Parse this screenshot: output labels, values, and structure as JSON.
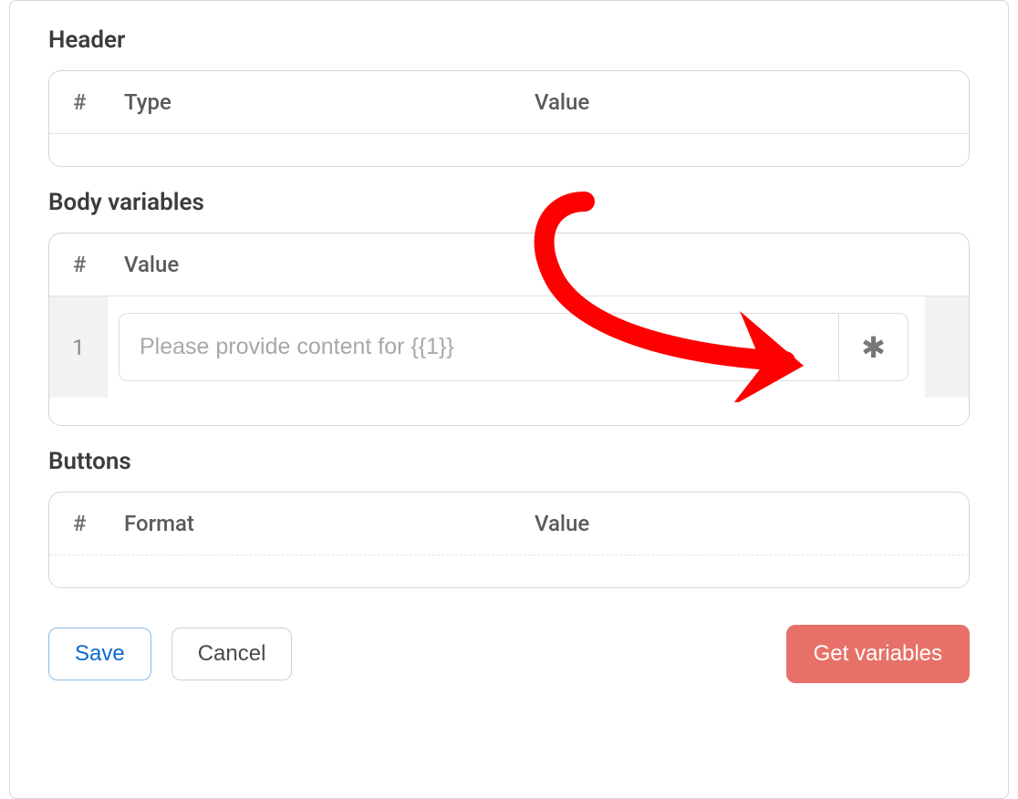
{
  "sections": {
    "header": {
      "title": "Header",
      "columns": {
        "hash": "#",
        "type": "Type",
        "value": "Value"
      }
    },
    "bodyVariables": {
      "title": "Body variables",
      "columns": {
        "hash": "#",
        "value": "Value"
      },
      "rows": [
        {
          "index": "1",
          "placeholder": "Please provide content for {{1}}",
          "value": "",
          "asterisk": "✱"
        }
      ]
    },
    "buttons": {
      "title": "Buttons",
      "columns": {
        "hash": "#",
        "format": "Format",
        "value": "Value"
      }
    }
  },
  "actions": {
    "save": "Save",
    "cancel": "Cancel",
    "getVariables": "Get variables"
  },
  "annotation": {
    "arrowColor": "#ff0000"
  }
}
